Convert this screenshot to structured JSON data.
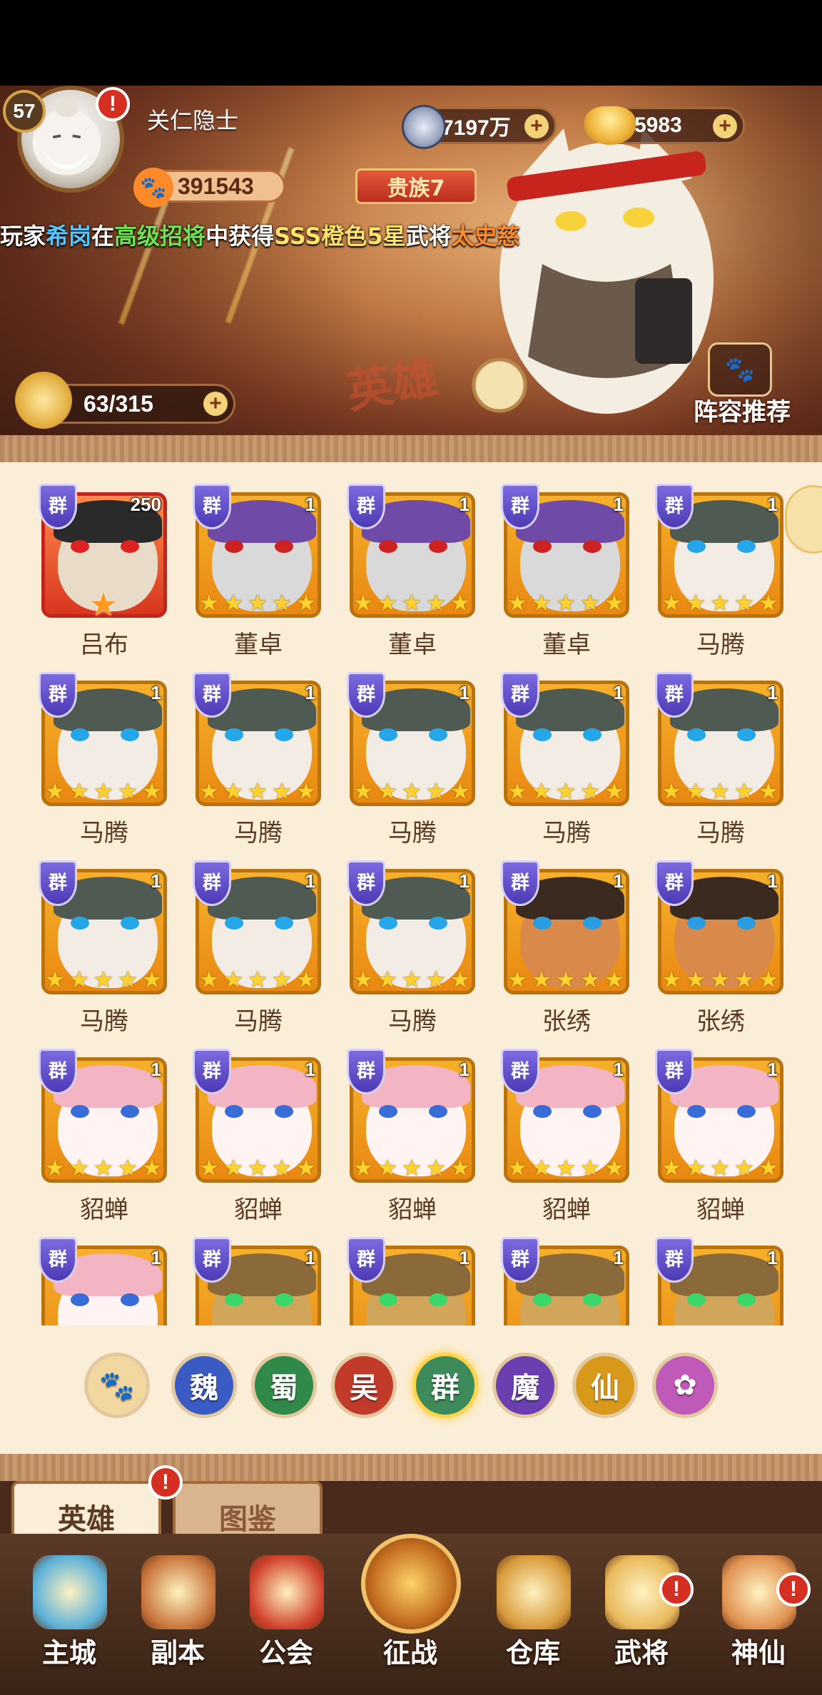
{
  "header": {
    "level": "57",
    "player_name": "关仁隐士",
    "coins": "7197万",
    "ingots": "5983",
    "power": "391543",
    "noble_rank": "贵族7"
  },
  "ticker": {
    "prefix": "玩家",
    "player": "希岗",
    "mid1": "在",
    "pool": "高级招将",
    "mid2": "中获得",
    "rarity": "SSS橙色5星",
    "mid3": "武将",
    "hero": "太史慈"
  },
  "capacity": "63/315",
  "recommend_label": "阵容推荐",
  "banner_title": "英雄",
  "faction_badge": "群",
  "heroes": [
    {
      "name": "吕布",
      "count": "250",
      "stars": 1,
      "face": "lubu"
    },
    {
      "name": "董卓",
      "count": "1",
      "stars": 5,
      "face": "dongzhuo"
    },
    {
      "name": "董卓",
      "count": "1",
      "stars": 5,
      "face": "dongzhuo"
    },
    {
      "name": "董卓",
      "count": "1",
      "stars": 5,
      "face": "dongzhuo"
    },
    {
      "name": "马腾",
      "count": "1",
      "stars": 5,
      "face": "mateng"
    },
    {
      "name": "马腾",
      "count": "1",
      "stars": 5,
      "face": "mateng"
    },
    {
      "name": "马腾",
      "count": "1",
      "stars": 5,
      "face": "mateng"
    },
    {
      "name": "马腾",
      "count": "1",
      "stars": 5,
      "face": "mateng"
    },
    {
      "name": "马腾",
      "count": "1",
      "stars": 5,
      "face": "mateng"
    },
    {
      "name": "马腾",
      "count": "1",
      "stars": 5,
      "face": "mateng"
    },
    {
      "name": "马腾",
      "count": "1",
      "stars": 5,
      "face": "mateng"
    },
    {
      "name": "马腾",
      "count": "1",
      "stars": 5,
      "face": "mateng"
    },
    {
      "name": "马腾",
      "count": "1",
      "stars": 5,
      "face": "mateng"
    },
    {
      "name": "张绣",
      "count": "1",
      "stars": 5,
      "face": "zhangxiu"
    },
    {
      "name": "张绣",
      "count": "1",
      "stars": 5,
      "face": "zhangxiu"
    },
    {
      "name": "貂蝉",
      "count": "1",
      "stars": 5,
      "face": "diaochan"
    },
    {
      "name": "貂蝉",
      "count": "1",
      "stars": 5,
      "face": "diaochan"
    },
    {
      "name": "貂蝉",
      "count": "1",
      "stars": 5,
      "face": "diaochan"
    },
    {
      "name": "貂蝉",
      "count": "1",
      "stars": 5,
      "face": "diaochan"
    },
    {
      "name": "貂蝉",
      "count": "1",
      "stars": 5,
      "face": "diaochan"
    },
    {
      "name": "",
      "count": "1",
      "stars": 0,
      "face": "diaochan"
    },
    {
      "name": "",
      "count": "1",
      "stars": 0,
      "face": "tiger"
    },
    {
      "name": "",
      "count": "1",
      "stars": 0,
      "face": "tiger"
    },
    {
      "name": "",
      "count": "1",
      "stars": 0,
      "face": "tiger"
    },
    {
      "name": "",
      "count": "1",
      "stars": 0,
      "face": "tiger"
    }
  ],
  "factions": [
    {
      "label": "🐾",
      "color": "#f3d7a0",
      "text": "#7a4a1a",
      "name": "all"
    },
    {
      "label": "魏",
      "color": "#3b5bc4",
      "text": "#ffffff",
      "name": "wei"
    },
    {
      "label": "蜀",
      "color": "#2f8a4a",
      "text": "#ffffff",
      "name": "shu"
    },
    {
      "label": "吴",
      "color": "#c23a2a",
      "text": "#ffffff",
      "name": "wu"
    },
    {
      "label": "群",
      "color": "#3d8a5a",
      "text": "#ffffff",
      "name": "qun",
      "selected": true
    },
    {
      "label": "魔",
      "color": "#6c3fb0",
      "text": "#ffffff",
      "name": "mo"
    },
    {
      "label": "仙",
      "color": "#d8991a",
      "text": "#ffffff",
      "name": "xian"
    },
    {
      "label": "✿",
      "color": "#c05ab8",
      "text": "#ffffff",
      "name": "special"
    }
  ],
  "tabs": {
    "heroes": "英雄",
    "codex": "图鉴"
  },
  "nav": [
    {
      "label": "主城",
      "name": "main-city",
      "color": "#5ab0d8"
    },
    {
      "label": "副本",
      "name": "dungeon",
      "color": "#c8743a"
    },
    {
      "label": "公会",
      "name": "guild",
      "color": "#d0402a"
    },
    {
      "label": "征战",
      "name": "campaign",
      "color": "#e0a040"
    },
    {
      "label": "仓库",
      "name": "warehouse",
      "color": "#d89a3a"
    },
    {
      "label": "武将",
      "name": "generals",
      "color": "#e8b85a"
    },
    {
      "label": "神仙",
      "name": "immortals",
      "color": "#e09050"
    }
  ],
  "alerts": {
    "avatar": "!",
    "tab": "!",
    "generals": "!",
    "immortals": "!"
  }
}
